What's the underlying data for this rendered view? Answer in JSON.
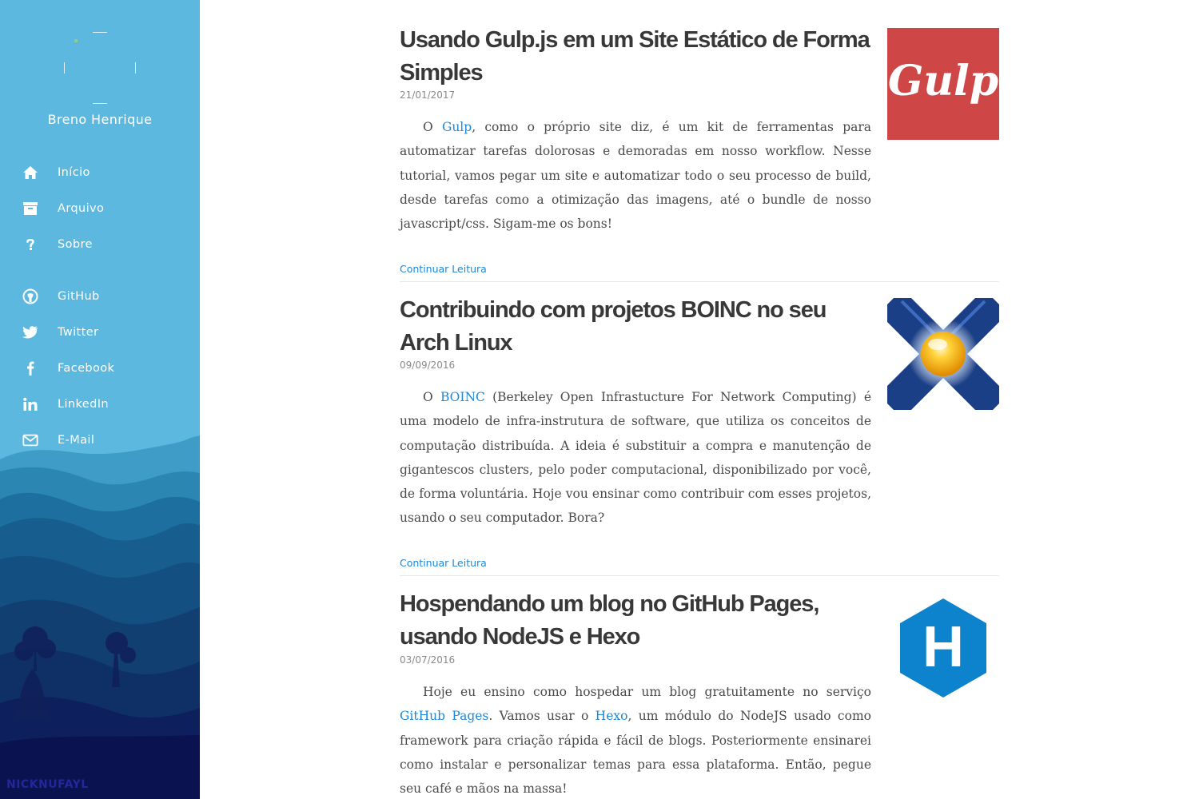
{
  "sidebar": {
    "author_name": "Breno Henrique",
    "nav": [
      {
        "label": "Início",
        "icon": "home-icon"
      },
      {
        "label": "Arquivo",
        "icon": "archive-icon"
      },
      {
        "label": "Sobre",
        "icon": "question-icon"
      }
    ],
    "social": [
      {
        "label": "GitHub",
        "icon": "github-icon"
      },
      {
        "label": "Twitter",
        "icon": "twitter-icon"
      },
      {
        "label": "Facebook",
        "icon": "facebook-icon"
      },
      {
        "label": "LinkedIn",
        "icon": "linkedin-icon"
      },
      {
        "label": "E-Mail",
        "icon": "envelope-icon"
      }
    ],
    "watermark": "NICKNUFAYL"
  },
  "posts": [
    {
      "title": "Usando Gulp.js em um Site Estático de Forma Simples",
      "date": "21/01/2017",
      "excerpt": {
        "pre": "O ",
        "link1": "Gulp",
        "mid": ", como o próprio site diz, é um kit de ferramentas para automatizar tarefas dolorosas e demoradas em nosso workflow. Nesse tutorial, vamos pegar um site e automatizar todo o seu processo de build, desde tarefas como a otimização das imagens, até o bundle de nosso javascript/css. Sigam-me os bons!"
      },
      "read_more": "Continuar Leitura",
      "thumb_text": "Gulp",
      "thumb_color": "#cf4646"
    },
    {
      "title": "Contribuindo com projetos BOINC no seu Arch Linux",
      "date": "09/09/2016",
      "excerpt": {
        "pre": "O ",
        "link1": "BOINC",
        "mid": " (Berkeley Open Infrastucture For Network Computing) é uma modelo de infra-instrutura de software, que utiliza os conceitos de computação distribuída. A ideia é substituir a compra e manutenção de gigantescos clusters, pelo poder computacional, disponibilizado por você, de forma voluntária. Hoje vou ensinar como contribuir com esses projetos, usando o seu computador. Bora?"
      },
      "read_more": "Continuar Leitura",
      "thumb_color": "#1b3f86"
    },
    {
      "title": "Hospendando um blog no GitHub Pages, usando NodeJS e Hexo",
      "date": "03/07/2016",
      "excerpt": {
        "pre": "Hoje eu ensino como hospedar um blog gratuitamente no serviço ",
        "link1": "GitHub Pages",
        "mid": ". Vamos usar o ",
        "link2": "Hexo",
        "post": ", um módulo do NodeJS usado como framework para criação rápida e fácil de blogs. Posteriormente ensinarei como instalar e personalizar temas para essa plataforma. Então, pegue seu café e mãos na massa!"
      },
      "thumb_text": "H",
      "thumb_color": "#0e83cd"
    }
  ],
  "colors": {
    "link": "#1e88d8",
    "sidebar_sky": "#5db8df",
    "title": "#383838"
  }
}
